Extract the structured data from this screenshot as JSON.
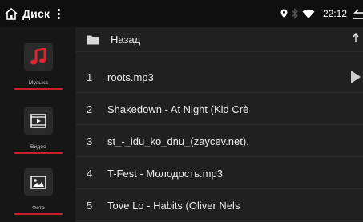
{
  "statusbar": {
    "title": "Диск",
    "time": "22:12"
  },
  "sidebar": {
    "items": [
      {
        "label": "Музыка",
        "icon": "music-icon",
        "active": true
      },
      {
        "label": "Видео",
        "icon": "video-icon",
        "active": false
      },
      {
        "label": "Фото",
        "icon": "photo-icon",
        "active": false
      }
    ]
  },
  "list": {
    "back_label": "Назад",
    "rows": [
      {
        "num": "1",
        "name": "roots.mp3"
      },
      {
        "num": "2",
        "name": "Shakedown - At Night (Kid Crè"
      },
      {
        "num": "3",
        "name": "st_-_idu_ko_dnu_(zaycev.net)."
      },
      {
        "num": "4",
        "name": "T-Fest - Молодость.mp3"
      },
      {
        "num": "5",
        "name": "Tove Lo - Habits (Oliver Nels"
      }
    ]
  },
  "colors": {
    "accent": "#c8202a",
    "background": "#1a1a1a"
  }
}
